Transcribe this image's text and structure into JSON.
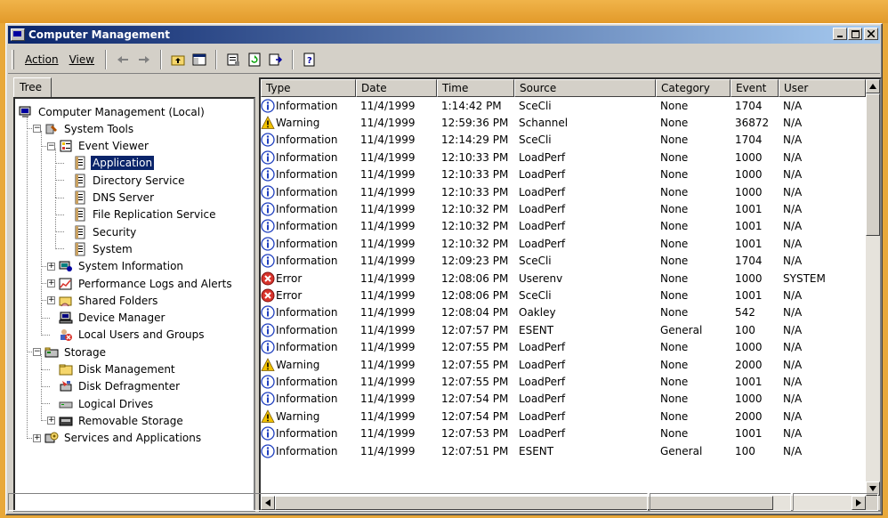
{
  "window": {
    "title": "Computer Management"
  },
  "menu": {
    "action": "Action",
    "view": "View"
  },
  "tree_tab": "Tree",
  "tree": [
    {
      "label": "Computer Management (Local)",
      "icon": "computer-management-icon",
      "level": 0,
      "toggle": ""
    },
    {
      "label": "System Tools",
      "icon": "tools-icon",
      "level": 1,
      "toggle": "-"
    },
    {
      "label": "Event Viewer",
      "icon": "event-viewer-icon",
      "level": 2,
      "toggle": "-"
    },
    {
      "label": "Application",
      "icon": "log-icon",
      "level": 3,
      "toggle": "",
      "selected": true
    },
    {
      "label": "Directory Service",
      "icon": "log-icon",
      "level": 3,
      "toggle": ""
    },
    {
      "label": "DNS Server",
      "icon": "log-icon",
      "level": 3,
      "toggle": ""
    },
    {
      "label": "File Replication Service",
      "icon": "log-icon",
      "level": 3,
      "toggle": ""
    },
    {
      "label": "Security",
      "icon": "log-icon",
      "level": 3,
      "toggle": ""
    },
    {
      "label": "System",
      "icon": "log-icon",
      "level": 3,
      "toggle": ""
    },
    {
      "label": "System Information",
      "icon": "system-info-icon",
      "level": 2,
      "toggle": "+"
    },
    {
      "label": "Performance Logs and Alerts",
      "icon": "performance-icon",
      "level": 2,
      "toggle": "+"
    },
    {
      "label": "Shared Folders",
      "icon": "shared-folder-icon",
      "level": 2,
      "toggle": "+"
    },
    {
      "label": "Device Manager",
      "icon": "device-manager-icon",
      "level": 2,
      "toggle": ""
    },
    {
      "label": "Local Users and Groups",
      "icon": "users-groups-icon",
      "level": 2,
      "toggle": ""
    },
    {
      "label": "Storage",
      "icon": "storage-icon",
      "level": 1,
      "toggle": "-"
    },
    {
      "label": "Disk Management",
      "icon": "disk-management-icon",
      "level": 2,
      "toggle": ""
    },
    {
      "label": "Disk Defragmenter",
      "icon": "defragmenter-icon",
      "level": 2,
      "toggle": ""
    },
    {
      "label": "Logical Drives",
      "icon": "logical-drive-icon",
      "level": 2,
      "toggle": ""
    },
    {
      "label": "Removable Storage",
      "icon": "removable-storage-icon",
      "level": 2,
      "toggle": "+"
    },
    {
      "label": "Services and Applications",
      "icon": "services-icon",
      "level": 1,
      "toggle": "+"
    }
  ],
  "columns": [
    "Type",
    "Date",
    "Time",
    "Source",
    "Category",
    "Event",
    "User"
  ],
  "events": [
    {
      "type": "Information",
      "date": "11/4/1999",
      "time": "1:14:42 PM",
      "source": "SceCli",
      "category": "None",
      "event": "1704",
      "user": "N/A"
    },
    {
      "type": "Warning",
      "date": "11/4/1999",
      "time": "12:59:36 PM",
      "source": "Schannel",
      "category": "None",
      "event": "36872",
      "user": "N/A"
    },
    {
      "type": "Information",
      "date": "11/4/1999",
      "time": "12:14:29 PM",
      "source": "SceCli",
      "category": "None",
      "event": "1704",
      "user": "N/A"
    },
    {
      "type": "Information",
      "date": "11/4/1999",
      "time": "12:10:33 PM",
      "source": "LoadPerf",
      "category": "None",
      "event": "1000",
      "user": "N/A"
    },
    {
      "type": "Information",
      "date": "11/4/1999",
      "time": "12:10:33 PM",
      "source": "LoadPerf",
      "category": "None",
      "event": "1000",
      "user": "N/A"
    },
    {
      "type": "Information",
      "date": "11/4/1999",
      "time": "12:10:33 PM",
      "source": "LoadPerf",
      "category": "None",
      "event": "1000",
      "user": "N/A"
    },
    {
      "type": "Information",
      "date": "11/4/1999",
      "time": "12:10:32 PM",
      "source": "LoadPerf",
      "category": "None",
      "event": "1001",
      "user": "N/A"
    },
    {
      "type": "Information",
      "date": "11/4/1999",
      "time": "12:10:32 PM",
      "source": "LoadPerf",
      "category": "None",
      "event": "1001",
      "user": "N/A"
    },
    {
      "type": "Information",
      "date": "11/4/1999",
      "time": "12:10:32 PM",
      "source": "LoadPerf",
      "category": "None",
      "event": "1001",
      "user": "N/A"
    },
    {
      "type": "Information",
      "date": "11/4/1999",
      "time": "12:09:23 PM",
      "source": "SceCli",
      "category": "None",
      "event": "1704",
      "user": "N/A"
    },
    {
      "type": "Error",
      "date": "11/4/1999",
      "time": "12:08:06 PM",
      "source": "Userenv",
      "category": "None",
      "event": "1000",
      "user": "SYSTEM"
    },
    {
      "type": "Error",
      "date": "11/4/1999",
      "time": "12:08:06 PM",
      "source": "SceCli",
      "category": "None",
      "event": "1001",
      "user": "N/A"
    },
    {
      "type": "Information",
      "date": "11/4/1999",
      "time": "12:08:04 PM",
      "source": "Oakley",
      "category": "None",
      "event": "542",
      "user": "N/A"
    },
    {
      "type": "Information",
      "date": "11/4/1999",
      "time": "12:07:57 PM",
      "source": "ESENT",
      "category": "General",
      "event": "100",
      "user": "N/A"
    },
    {
      "type": "Information",
      "date": "11/4/1999",
      "time": "12:07:55 PM",
      "source": "LoadPerf",
      "category": "None",
      "event": "1000",
      "user": "N/A"
    },
    {
      "type": "Warning",
      "date": "11/4/1999",
      "time": "12:07:55 PM",
      "source": "LoadPerf",
      "category": "None",
      "event": "2000",
      "user": "N/A"
    },
    {
      "type": "Information",
      "date": "11/4/1999",
      "time": "12:07:55 PM",
      "source": "LoadPerf",
      "category": "None",
      "event": "1001",
      "user": "N/A"
    },
    {
      "type": "Information",
      "date": "11/4/1999",
      "time": "12:07:54 PM",
      "source": "LoadPerf",
      "category": "None",
      "event": "1000",
      "user": "N/A"
    },
    {
      "type": "Warning",
      "date": "11/4/1999",
      "time": "12:07:54 PM",
      "source": "LoadPerf",
      "category": "None",
      "event": "2000",
      "user": "N/A"
    },
    {
      "type": "Information",
      "date": "11/4/1999",
      "time": "12:07:53 PM",
      "source": "LoadPerf",
      "category": "None",
      "event": "1001",
      "user": "N/A"
    },
    {
      "type": "Information",
      "date": "11/4/1999",
      "time": "12:07:51 PM",
      "source": "ESENT",
      "category": "General",
      "event": "100",
      "user": "N/A"
    }
  ],
  "toolbar_icons": [
    "back-arrow-icon",
    "forward-arrow-icon",
    "up-folder-icon",
    "show-hide-tree-icon",
    "properties-icon",
    "refresh-icon",
    "export-list-icon",
    "help-icon"
  ],
  "colors": {
    "title_start": "#0a246a",
    "title_end": "#a6caf0",
    "selection": "#0a246a",
    "info": "#1f3fbf",
    "warning": "#f2c200",
    "error": "#d8342c",
    "frame": "#e8a83a"
  }
}
